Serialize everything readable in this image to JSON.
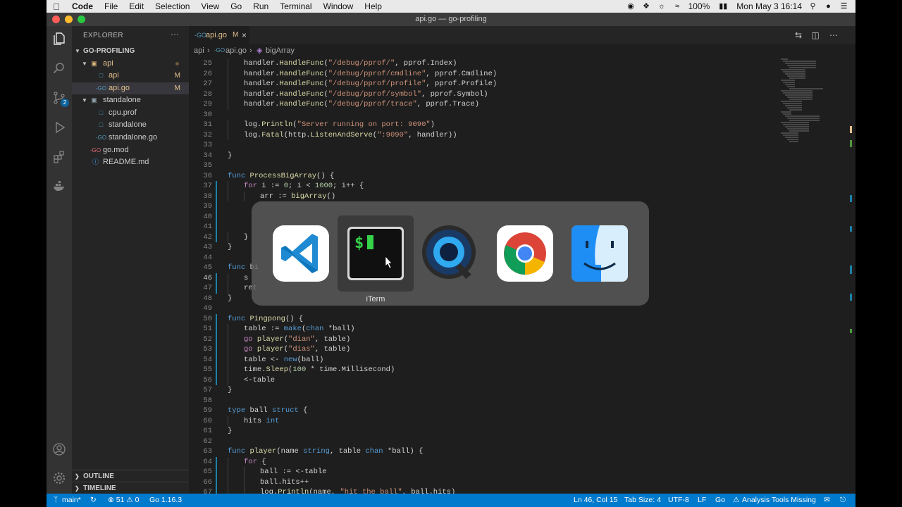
{
  "menubar": {
    "items": [
      "Code",
      "File",
      "Edit",
      "Selection",
      "View",
      "Go",
      "Run",
      "Terminal",
      "Window",
      "Help"
    ],
    "battery": "100%",
    "clock": "Mon May 3  16:14"
  },
  "window": {
    "title": "api.go — go-profiling"
  },
  "activity_bar": {
    "scm_badge": "2"
  },
  "sidebar": {
    "title": "EXPLORER",
    "more": "···",
    "project": "GO-PROFILING",
    "tree": [
      {
        "name": "api",
        "kind": "folder",
        "decoration": ""
      },
      {
        "name": "api",
        "kind": "file",
        "decoration": "M"
      },
      {
        "name": "api.go",
        "kind": "go",
        "decoration": "M"
      },
      {
        "name": "standalone",
        "kind": "folder",
        "decoration": ""
      },
      {
        "name": "cpu.prof",
        "kind": "file",
        "decoration": ""
      },
      {
        "name": "standalone",
        "kind": "file",
        "decoration": ""
      },
      {
        "name": "standalone.go",
        "kind": "go",
        "decoration": ""
      },
      {
        "name": "go.mod",
        "kind": "mod",
        "decoration": ""
      },
      {
        "name": "README.md",
        "kind": "md",
        "decoration": ""
      }
    ],
    "sections": [
      "OUTLINE",
      "TIMELINE"
    ]
  },
  "tab": {
    "name": "api.go",
    "modified": "M",
    "close": "×"
  },
  "breadcrumb": {
    "folder": "api",
    "file": "api.go",
    "symbol": "bigArray"
  },
  "code": [
    {
      "n": "25",
      "t": "handler.HandleFunc(\"/debug/pprof/\", pprof.Index)"
    },
    {
      "n": "26",
      "t": "handler.HandleFunc(\"/debug/pprof/cmdline\", pprof.Cmdline)"
    },
    {
      "n": "27",
      "t": "handler.HandleFunc(\"/debug/pprof/profile\", pprof.Profile)"
    },
    {
      "n": "28",
      "t": "handler.HandleFunc(\"/debug/pprof/symbol\", pprof.Symbol)"
    },
    {
      "n": "29",
      "t": "handler.HandleFunc(\"/debug/pprof/trace\", pprof.Trace)"
    },
    {
      "n": "30",
      "t": ""
    },
    {
      "n": "31",
      "t": "log.Println(\"Server running on port: 9090\")"
    },
    {
      "n": "32",
      "t": "log.Fatal(http.ListenAndServe(\":9090\", handler))"
    },
    {
      "n": "33",
      "t": ""
    },
    {
      "n": "34",
      "t": "}"
    },
    {
      "n": "35",
      "t": ""
    },
    {
      "n": "36",
      "t": "func ProcessBigArray() {"
    },
    {
      "n": "37",
      "t": "for i := 0; i < 1000; i++ {"
    },
    {
      "n": "38",
      "t": "arr := bigArray()"
    },
    {
      "n": "39",
      "t": ""
    },
    {
      "n": "40",
      "t": ""
    },
    {
      "n": "41",
      "t": ""
    },
    {
      "n": "42",
      "t": "}"
    },
    {
      "n": "43",
      "t": "}"
    },
    {
      "n": "44",
      "t": ""
    },
    {
      "n": "45",
      "t": "func bi"
    },
    {
      "n": "46",
      "t": "s"
    },
    {
      "n": "47",
      "t": "ret"
    },
    {
      "n": "48",
      "t": "}"
    },
    {
      "n": "49",
      "t": ""
    },
    {
      "n": "50",
      "t": "func Pingpong() {"
    },
    {
      "n": "51",
      "t": "table := make(chan *ball)"
    },
    {
      "n": "52",
      "t": "go player(\"dian\", table)"
    },
    {
      "n": "53",
      "t": "go player(\"dias\", table)"
    },
    {
      "n": "54",
      "t": "table <- new(ball)"
    },
    {
      "n": "55",
      "t": "time.Sleep(100 * time.Millisecond)"
    },
    {
      "n": "56",
      "t": "<-table"
    },
    {
      "n": "57",
      "t": "}"
    },
    {
      "n": "58",
      "t": ""
    },
    {
      "n": "59",
      "t": "type ball struct {"
    },
    {
      "n": "60",
      "t": "hits int"
    },
    {
      "n": "61",
      "t": "}"
    },
    {
      "n": "62",
      "t": ""
    },
    {
      "n": "63",
      "t": "func player(name string, table chan *ball) {"
    },
    {
      "n": "64",
      "t": "for {"
    },
    {
      "n": "65",
      "t": "ball := <-table"
    },
    {
      "n": "66",
      "t": "ball.hits++"
    },
    {
      "n": "67",
      "t": "log.Println(name, \"hit the ball\", ball.hits)"
    }
  ],
  "app_switcher": {
    "apps": [
      {
        "icon": "vscode-icon",
        "label": ""
      },
      {
        "icon": "iterm-icon",
        "label": "iTerm"
      },
      {
        "icon": "quicktime-icon",
        "label": ""
      },
      {
        "icon": "chrome-icon",
        "label": ""
      },
      {
        "icon": "finder-icon",
        "label": ""
      }
    ],
    "selected": "iTerm",
    "terminal_glyph": "$"
  },
  "statusbar": {
    "branch": "main*",
    "problems": "⊗ 51 ⚠ 0",
    "go_version": "Go 1.16.3",
    "position": "Ln 46, Col 15",
    "tab_size": "Tab Size: 4",
    "encoding": "UTF-8",
    "eol": "LF",
    "language": "Go",
    "analysis": "Analysis Tools Missing"
  },
  "colors": {
    "statusbar": "#007acc",
    "editor_bg": "#1e1e1e",
    "sidebar_bg": "#252526",
    "modified": "#e2c08d"
  }
}
